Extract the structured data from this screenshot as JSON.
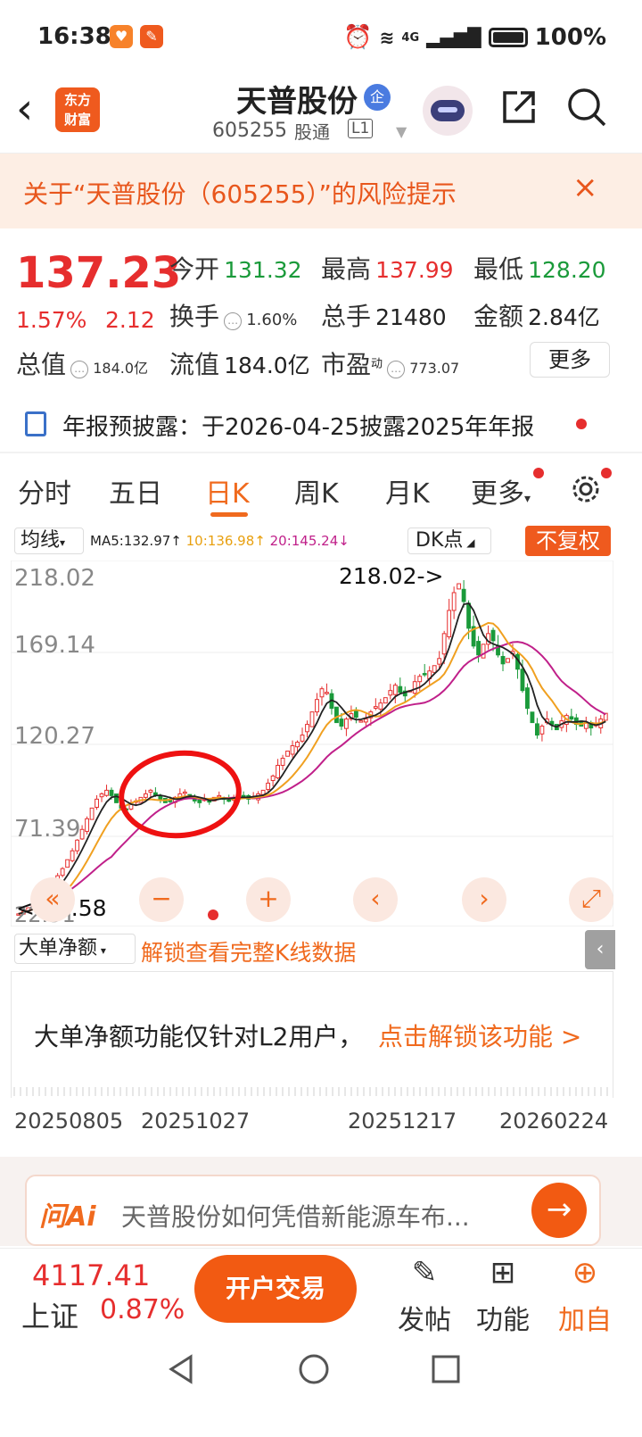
{
  "status": {
    "time": "16:38",
    "network": "4G",
    "battery": "100%"
  },
  "header": {
    "brand_logo": "东方\n财富",
    "name": "天普股份",
    "badge": "企",
    "code": "605255",
    "tong": "股通",
    "level": "L1"
  },
  "risk": {
    "text": "关于“天普股份（605255）”的风险提示",
    "close": "×"
  },
  "quote": {
    "price": "137.23",
    "pct": "1.57%",
    "change": "2.12",
    "open_label": "今开",
    "open": "131.32",
    "high_label": "最高",
    "high": "137.99",
    "low_label": "最低",
    "low": "128.20",
    "turnover_label": "换手",
    "turnover": "1.60%",
    "volume_label": "总手",
    "volume": "21480",
    "amount_label": "金额",
    "amount": "2.84亿",
    "mktcap_label": "总值",
    "mktcap": "184.0亿",
    "float_label": "流值",
    "float": "184.0亿",
    "pe_label": "市盈",
    "pe_sup": "动",
    "pe": "773.07",
    "more": "更多"
  },
  "report": {
    "text": "年报预披露：于2026-04-25披露2025年年报"
  },
  "tabs": [
    "分时",
    "五日",
    "日K",
    "周K",
    "月K",
    "更多"
  ],
  "toolbar": {
    "ma_select": "均线",
    "ma5": "MA5:132.97↑",
    "ma10": "10:136.98↑",
    "ma20": "20:145.24↓",
    "dk_select": "DK点",
    "fq_button": "不复权"
  },
  "chart_data": {
    "type": "candlestick",
    "y_ticks": [
      "218.02",
      "169.14",
      "120.27",
      "71.39",
      "22.51"
    ],
    "ylim": [
      22.51,
      218.02
    ],
    "max_marker": "218.02->",
    "min_marker": "<-24.58",
    "signal_marker": "S",
    "x_labels": [
      "20250805",
      "20251027",
      "20251217",
      "20260224"
    ],
    "colors": {
      "up": "#e62e2e",
      "down": "#1a9a3a",
      "ma5": "#222222",
      "ma10": "#f0a020",
      "ma20": "#c0208a",
      "annotation": "#ee1111"
    },
    "closes": [
      24.58,
      26,
      28,
      30,
      32,
      35,
      38,
      42,
      46,
      50,
      55,
      60,
      66,
      72,
      78,
      84,
      89,
      92,
      94,
      91,
      87,
      84,
      83,
      86,
      88,
      90,
      92,
      94,
      91,
      89,
      87,
      88,
      90,
      92,
      93,
      90,
      88,
      87,
      89,
      88,
      90,
      91,
      89,
      88,
      90,
      92,
      91,
      89,
      90,
      92,
      94,
      98,
      102,
      108,
      112,
      116,
      119,
      121,
      125,
      131,
      138,
      145,
      151,
      149,
      140,
      132,
      130,
      134,
      137,
      135,
      133,
      134,
      138,
      141,
      143,
      146,
      150,
      153,
      149,
      147,
      150,
      155,
      158,
      159,
      161,
      164,
      168,
      182,
      195,
      205,
      210,
      200,
      185,
      175,
      170,
      176,
      182,
      178,
      170,
      165,
      168,
      172,
      162,
      150,
      140,
      132,
      125,
      130,
      134,
      131,
      128,
      133,
      136,
      134,
      131,
      130,
      132,
      129,
      131,
      134,
      137.23
    ]
  },
  "chart_controls": [
    "«",
    "−",
    "+",
    "‹",
    "›",
    "⤢"
  ],
  "bigorder": {
    "select": "大单净额",
    "unlock": "解锁查看完整K线数据",
    "msg": "大单净额功能仅针对L2用户，",
    "cta": "点击解锁该功能 >"
  },
  "ai": {
    "logo": "问Ai",
    "question": "天普股份如何凭借新能源车布..."
  },
  "bottom": {
    "index_value": "4117.41",
    "index_name": "上证",
    "index_pct": "0.87%",
    "open_account": "开户交易",
    "post": "发帖",
    "function": "功能",
    "add": "加自"
  }
}
